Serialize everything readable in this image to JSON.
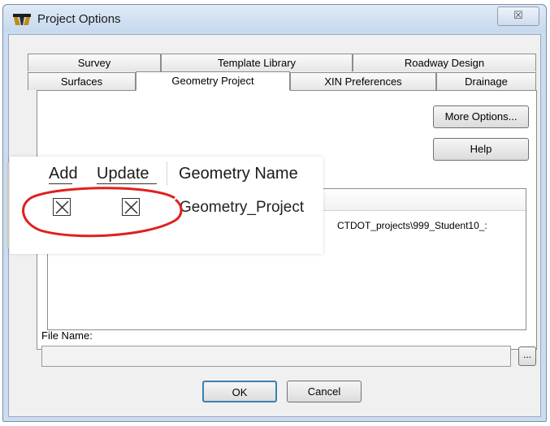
{
  "window": {
    "title": "Project Options",
    "close_glyph": "☒",
    "icon": "roadway-app-icon"
  },
  "tabs": {
    "row_back": [
      {
        "label": "Survey"
      },
      {
        "label": "Template Library"
      },
      {
        "label": "Roadway Design"
      }
    ],
    "row_front": [
      {
        "label": "Surfaces"
      },
      {
        "label": "Geometry Project"
      },
      {
        "label": "XIN Preferences"
      },
      {
        "label": "Drainage"
      }
    ],
    "active": "Geometry Project"
  },
  "buttons": {
    "more_options": "More Options...",
    "help": "Help",
    "ok": "OK",
    "cancel": "Cancel",
    "browse": "..."
  },
  "list": {
    "columns": [
      "Add",
      "Update",
      "Geometry Name"
    ],
    "rows": [
      {
        "add": true,
        "update": true,
        "name": "Geometry_Project",
        "path": "CTDOT_projects\\999_Student10_:"
      }
    ]
  },
  "file": {
    "label": "File Name:",
    "value": ""
  },
  "annotation": {
    "color": "#e02020"
  }
}
